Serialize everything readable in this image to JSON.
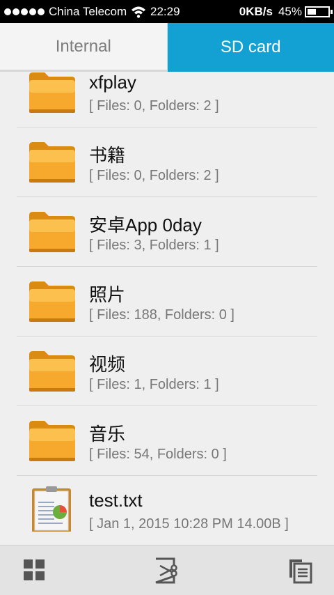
{
  "status": {
    "carrier": "China Telecom",
    "time": "22:29",
    "speed": "0KB/s",
    "battery": "45%",
    "battery_level": 0.45
  },
  "tabs": [
    {
      "label": "Internal",
      "active": false
    },
    {
      "label": "SD card",
      "active": true
    }
  ],
  "items": [
    {
      "name": "xfplay",
      "meta": "[ Files: 0, Folders: 2 ]",
      "icon": "folder-icon"
    },
    {
      "name": "书籍",
      "meta": "[ Files: 0, Folders: 2 ]",
      "icon": "folder-icon"
    },
    {
      "name": "安卓App 0day",
      "meta": "[ Files: 3, Folders: 1 ]",
      "icon": "folder-icon"
    },
    {
      "name": "照片",
      "meta": "[ Files: 188, Folders: 0 ]",
      "icon": "folder-icon"
    },
    {
      "name": "视频",
      "meta": "[ Files: 1, Folders: 1 ]",
      "icon": "folder-icon"
    },
    {
      "name": "音乐",
      "meta": "[ Files: 54, Folders: 0 ]",
      "icon": "folder-icon"
    },
    {
      "name": "test.txt",
      "meta": "[ Jan 1, 2015 10:28 PM 14.00B ]",
      "icon": "text-file-icon"
    }
  ],
  "toolbar": {
    "buttons": [
      {
        "icon": "grid-view-icon"
      },
      {
        "icon": "cut-icon"
      },
      {
        "icon": "copy-icon"
      }
    ]
  },
  "colors": {
    "accent": "#13a1d3",
    "folder": "#f5a623"
  }
}
